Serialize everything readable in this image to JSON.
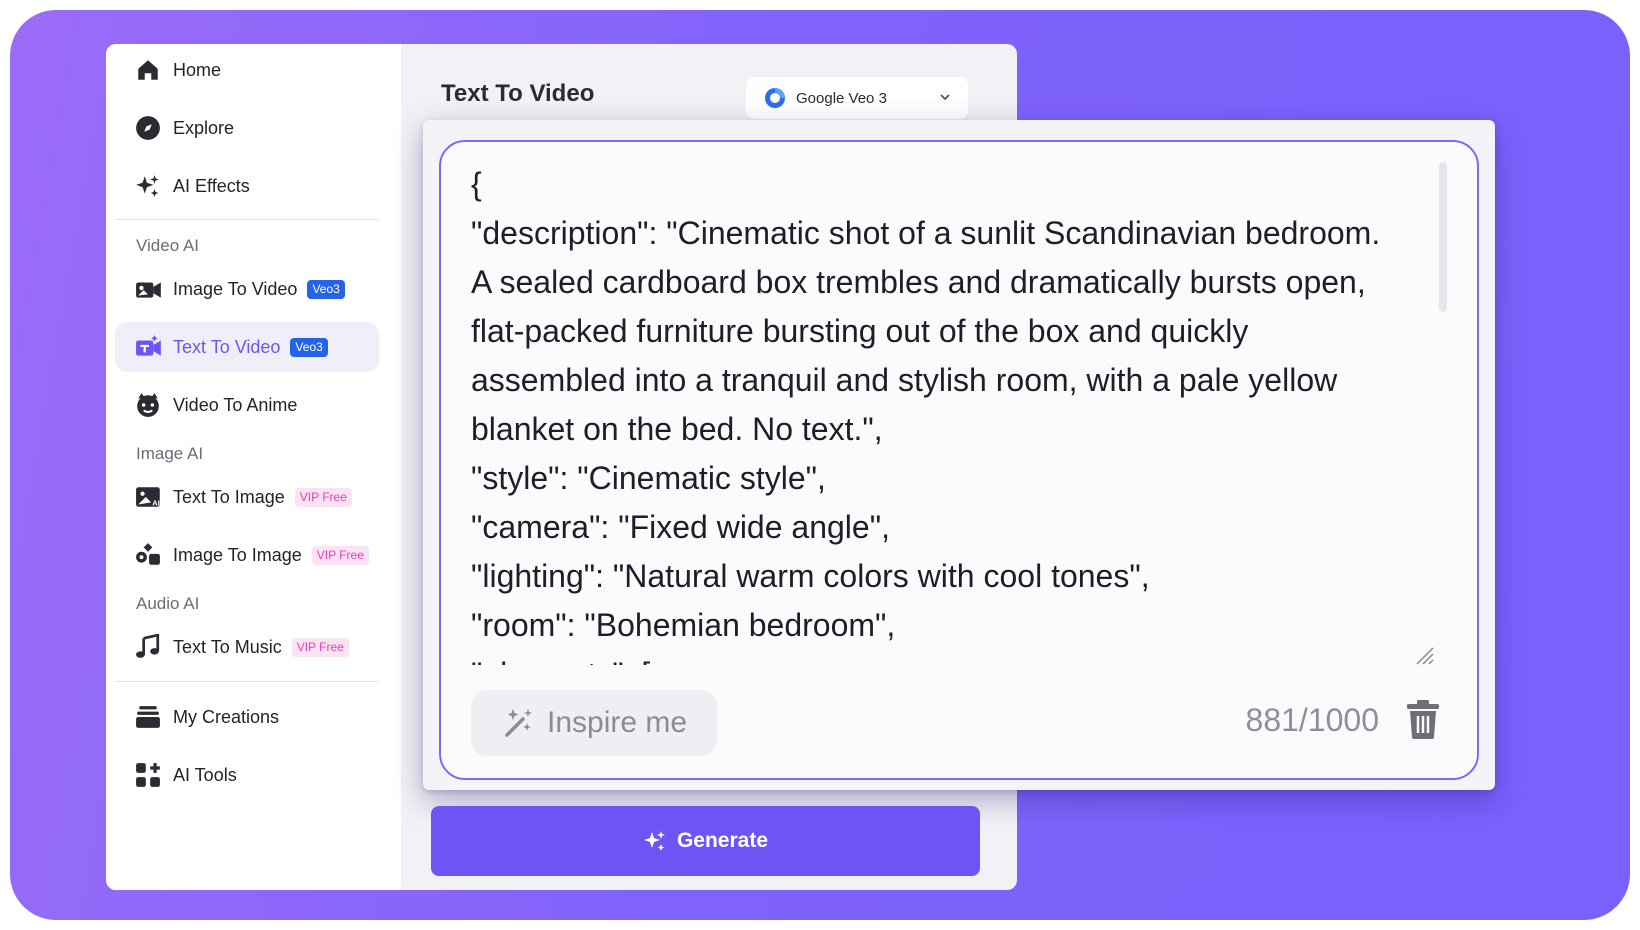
{
  "sidebar": {
    "top_items": [
      {
        "label": "Home"
      },
      {
        "label": "Explore"
      },
      {
        "label": "AI Effects"
      }
    ],
    "sections": {
      "video_ai": "Video AI",
      "image_ai": "Image AI",
      "audio_ai": "Audio AI"
    },
    "video_items": [
      {
        "label": "Image To Video",
        "badge": "Veo3"
      },
      {
        "label": "Text To Video",
        "badge": "Veo3",
        "active": true
      },
      {
        "label": "Video To Anime"
      }
    ],
    "image_items": [
      {
        "label": "Text To Image",
        "badge": "VIP Free"
      },
      {
        "label": "Image To Image",
        "badge": "VIP Free"
      }
    ],
    "audio_items": [
      {
        "label": "Text To Music",
        "badge": "VIP Free"
      }
    ],
    "bottom_items": [
      {
        "label": "My Creations"
      },
      {
        "label": "AI Tools"
      }
    ]
  },
  "main": {
    "title": "Text To Video",
    "model": {
      "name": "Google Veo 3"
    },
    "prompt": {
      "text": "{\n\"description\": \"Cinematic shot of a sunlit Scandinavian bedroom. A sealed cardboard box trembles and dramatically bursts open, flat-packed furniture bursting out of the box and quickly assembled into a tranquil and stylish room, with a pale yellow blanket on the bed. No text.\",\n\"style\": \"Cinematic style\",\n\"camera\": \"Fixed wide angle\",\n\"lighting\": \"Natural warm colors with cool tones\",\n\"room\": \"Bohemian bedroom\",\n\"elements\": [",
      "counter": "881/1000"
    },
    "inspire_label": "Inspire me",
    "generate_label": "Generate"
  },
  "colors": {
    "accent": "#6d55f5",
    "background_gradient_start": "#9b6cf7",
    "background_gradient_end": "#7a60fd",
    "veo_badge": "#2563eb",
    "vip_badge_text": "#e63fbd"
  },
  "icons": {
    "home": "home-icon",
    "explore": "compass-icon",
    "ai_effects": "sparkles-icon",
    "image_to_video": "image-video-icon",
    "text_to_video": "text-video-icon",
    "video_to_anime": "anime-face-icon",
    "text_to_image": "text-image-icon",
    "image_to_image": "image-swap-icon",
    "text_to_music": "music-note-icon",
    "my_creations": "stack-icon",
    "ai_tools": "grid-plus-icon",
    "model": "google-veo-logo",
    "inspire": "magic-wand-icon",
    "trash": "trash-icon"
  }
}
